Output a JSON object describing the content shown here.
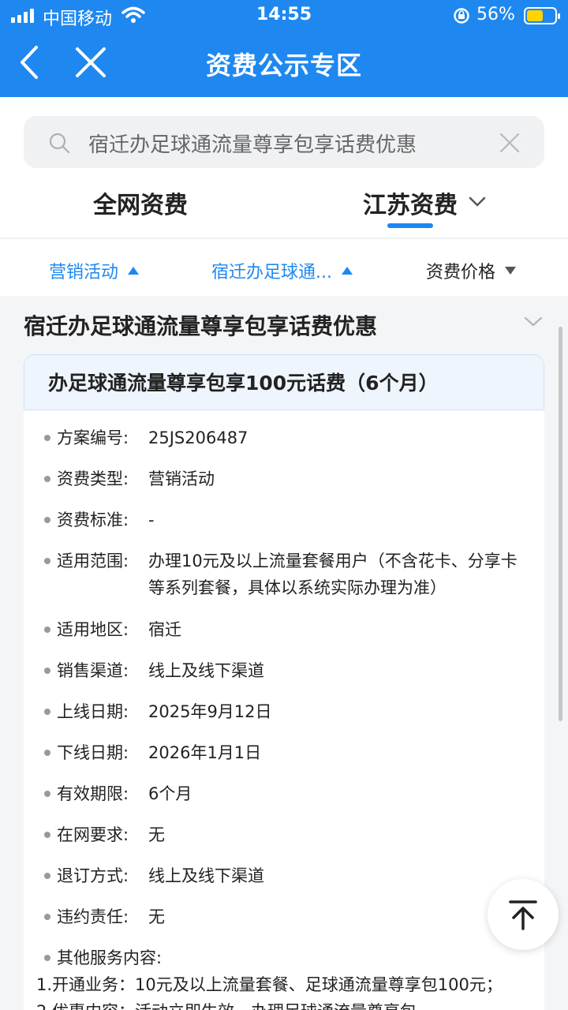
{
  "status_bar": {
    "carrier": "中国移动",
    "time": "14:55",
    "battery": "56%"
  },
  "nav": {
    "title": "资费公示专区"
  },
  "search": {
    "query": "宿迁办足球通流量尊享包享话费优惠"
  },
  "tabs": [
    {
      "label": "全网资费"
    },
    {
      "label": "江苏资费"
    }
  ],
  "filters": [
    {
      "label": "营销活动"
    },
    {
      "label": "宿迁办足球通..."
    },
    {
      "label": "资费价格"
    }
  ],
  "group": {
    "title": "宿迁办足球通流量尊享包享话费优惠"
  },
  "card": {
    "title": "办足球通流量尊享包享100元话费（6个月）",
    "rows": [
      {
        "label": "方案编号:",
        "value": "25JS206487"
      },
      {
        "label": "资费类型:",
        "value": "营销活动"
      },
      {
        "label": "资费标准:",
        "value": "-"
      },
      {
        "label": "适用范围:",
        "value": "办理10元及以上流量套餐用户（不含花卡、分享卡等系列套餐，具体以系统实际办理为准）"
      },
      {
        "label": "适用地区:",
        "value": "宿迁"
      },
      {
        "label": "销售渠道:",
        "value": "线上及线下渠道"
      },
      {
        "label": "上线日期:",
        "value": "2025年9月12日"
      },
      {
        "label": "下线日期:",
        "value": "2026年1月1日"
      },
      {
        "label": "有效期限:",
        "value": "6个月"
      },
      {
        "label": "在网要求:",
        "value": "无"
      },
      {
        "label": "退订方式:",
        "value": "线上及线下渠道"
      },
      {
        "label": "违约责任:",
        "value": "无"
      }
    ],
    "other": {
      "label": "其他服务内容:",
      "value": "1.开通业务：10元及以上流量套餐、足球通流量尊享包100元； 2.优惠内容：活动立即生效，办理足球通流量尊享包"
    }
  }
}
